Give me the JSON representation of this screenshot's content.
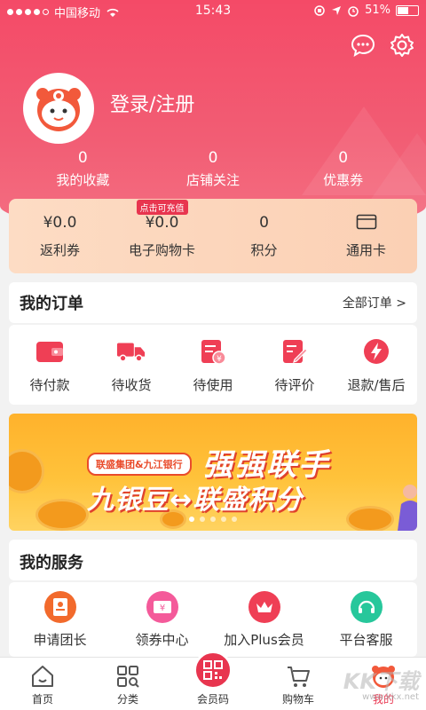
{
  "status": {
    "carrier": "中国移动",
    "time": "15:43",
    "battery": "51%"
  },
  "header": {
    "login_label": "登录/注册"
  },
  "stats": [
    {
      "value": "0",
      "label": "我的收藏"
    },
    {
      "value": "0",
      "label": "店铺关注"
    },
    {
      "value": "0",
      "label": "优惠券"
    }
  ],
  "wallet": [
    {
      "value": "¥0.0",
      "label": "返利券"
    },
    {
      "value": "¥0.0",
      "label": "电子购物卡",
      "tag": "点击可充值"
    },
    {
      "value": "0",
      "label": "积分"
    },
    {
      "value": "",
      "label": "通用卡",
      "icon": "card-icon"
    }
  ],
  "orders": {
    "title": "我的订单",
    "more": "全部订单 >",
    "items": [
      {
        "label": "待付款",
        "icon": "wallet-icon"
      },
      {
        "label": "待收货",
        "icon": "truck-icon"
      },
      {
        "label": "待使用",
        "icon": "receipt-icon"
      },
      {
        "label": "待评价",
        "icon": "edit-icon"
      },
      {
        "label": "退款/售后",
        "icon": "lightning-icon"
      }
    ]
  },
  "banner": {
    "pill": "联盛集团&九江银行",
    "headline": "强强联手",
    "subline": "九银豆↔联盛积分"
  },
  "services": {
    "title": "我的服务",
    "items": [
      {
        "label": "申请团长",
        "icon": "badge-icon",
        "color": "#f26a2c"
      },
      {
        "label": "领券中心",
        "icon": "coupon-icon",
        "color": "#f45a9a"
      },
      {
        "label": "加入Plus会员",
        "icon": "crown-icon",
        "color": "#ef3f55"
      },
      {
        "label": "平台客服",
        "icon": "headset-icon",
        "color": "#27c79b"
      }
    ]
  },
  "tabs": [
    {
      "label": "首页",
      "icon": "home-icon"
    },
    {
      "label": "分类",
      "icon": "category-icon"
    },
    {
      "label": "会员码",
      "icon": "qr-icon"
    },
    {
      "label": "购物车",
      "icon": "cart-icon"
    },
    {
      "label": "我的",
      "icon": "mascot-icon"
    }
  ],
  "watermark": {
    "text": "KK下载",
    "url": "www.kkx.net"
  },
  "colors": {
    "primary": "#e8354f",
    "header": "#f44a67",
    "banner": "#ffb22c"
  }
}
